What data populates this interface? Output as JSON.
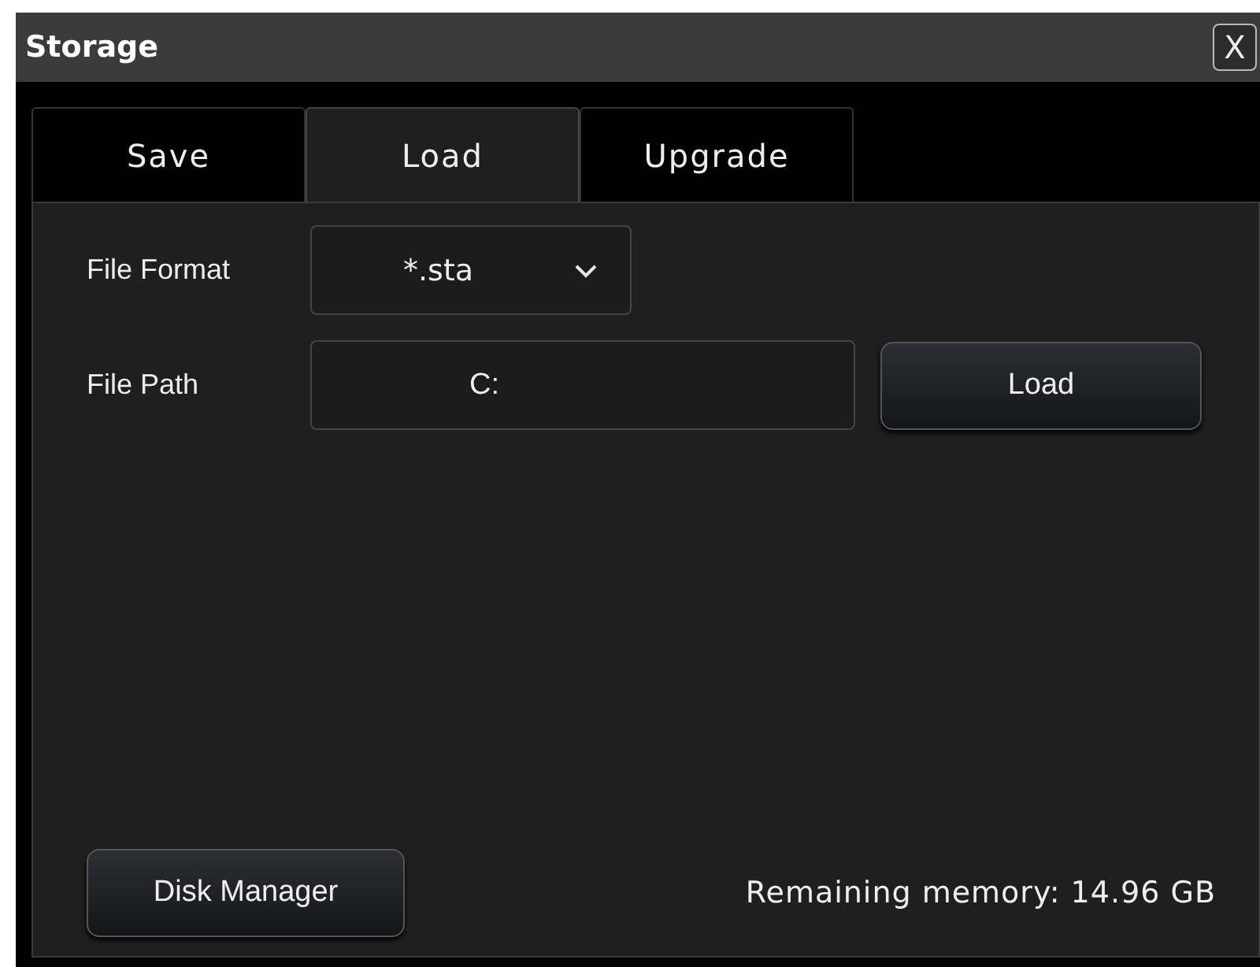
{
  "window": {
    "title": "Storage",
    "close": "X"
  },
  "tabs": [
    {
      "label": "Save",
      "selected": false
    },
    {
      "label": "Load",
      "selected": true
    },
    {
      "label": "Upgrade",
      "selected": false
    }
  ],
  "form": {
    "file_format": {
      "label": "File Format",
      "value": "*.sta"
    },
    "file_path": {
      "label": "File Path",
      "value": "C:"
    },
    "load_button": "Load"
  },
  "footer": {
    "disk_manager_button": "Disk Manager",
    "remaining_memory": "Remaining memory: 14.96 GB"
  }
}
